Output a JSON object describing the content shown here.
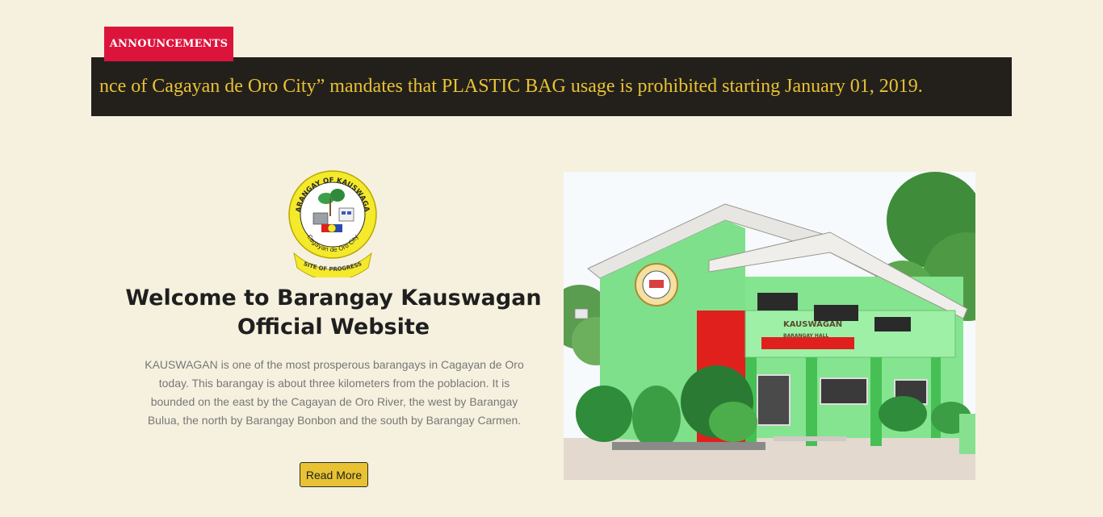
{
  "announcement": {
    "tab_label": "ANNOUNCEMENTS",
    "ticker_text": "nce of Cagayan de Oro City” mandates that PLASTIC BAG usage is prohibited starting January 01, 2019.",
    "tab_color": "#dc143c",
    "ticker_bg": "#23201c",
    "ticker_text_color": "#e8c233"
  },
  "logo": {
    "ring_text": "BARANGAY OF KAUSWAGAN",
    "city_text": "Cagayan de Oro City",
    "ribbon_text": "SITE OF PROGRESS",
    "icon": "barangay-seal-icon"
  },
  "welcome": {
    "title": "Welcome to Barangay Kauswagan Official Website",
    "description": "KAUSWAGAN is one of the most prosperous barangays in Cagayan de Oro today. This barangay is about three kilometers from the poblacion. It is bounded on the east by the Cagayan de Oro River, the west by Barangay Bulua, the north by Barangay Bonbon and the south by Barangay Carmen.",
    "read_more_label": "Read More",
    "button_color": "#e8c233"
  },
  "photo": {
    "sign_line1": "KAUSWAGAN",
    "sign_line2": "BARANGAY HALL",
    "building_color": "#7ee08a",
    "accent_color": "#e0201c"
  }
}
